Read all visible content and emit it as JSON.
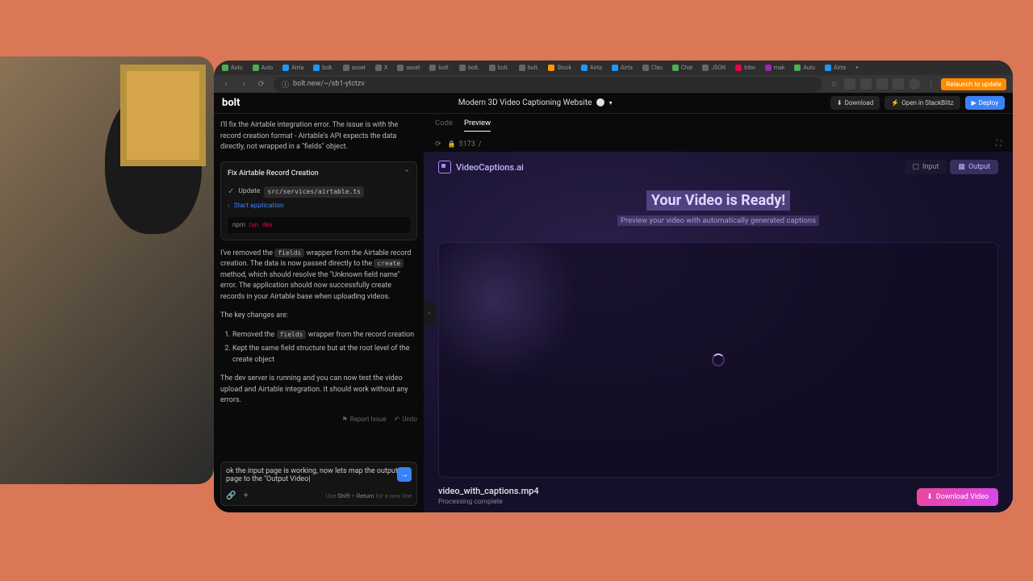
{
  "browser": {
    "tabs": [
      {
        "icon": "green",
        "label": "Auto"
      },
      {
        "icon": "green",
        "label": "Auto"
      },
      {
        "icon": "blue",
        "label": "Airta"
      },
      {
        "icon": "blue",
        "label": "bolt."
      },
      {
        "icon": "gray",
        "label": "asset"
      },
      {
        "icon": "gray",
        "label": "X"
      },
      {
        "icon": "gray",
        "label": "asset"
      },
      {
        "icon": "gray",
        "label": "bolt."
      },
      {
        "icon": "gray",
        "label": "bolt."
      },
      {
        "icon": "gray",
        "label": "bolt."
      },
      {
        "icon": "gray",
        "label": "bolt."
      },
      {
        "icon": "orange",
        "label": "Stock"
      },
      {
        "icon": "blue",
        "label": "Airta"
      },
      {
        "icon": "blue",
        "label": "Airta"
      },
      {
        "icon": "gray",
        "label": "Clau"
      },
      {
        "icon": "green",
        "label": "Chat"
      },
      {
        "icon": "gray",
        "label": "JSON"
      },
      {
        "icon": "red",
        "label": "Inbo"
      },
      {
        "icon": "purple",
        "label": "mak"
      },
      {
        "icon": "green",
        "label": "Auto"
      },
      {
        "icon": "blue",
        "label": "Airta"
      }
    ],
    "url": "bolt.new/~/sb1-ytctzv",
    "relaunch": "Relaunch to update"
  },
  "header": {
    "logo": "bolt",
    "project": "Modern 3D Video Captioning Website",
    "download": "Download",
    "stackblitz": "Open in StackBlitz",
    "deploy": "Deploy"
  },
  "chat": {
    "intro": "I'll fix the Airtable integration error. The issue is with the record creation format - Airtable's API expects the data directly, not wrapped in a \"fields\" object.",
    "fix_title": "Fix Airtable Record Creation",
    "step_update": "Update",
    "step_file": "src/services/airtable.ts",
    "step_start": "Start application",
    "cmd_npm": "npm",
    "cmd_run": "run",
    "cmd_dev": "dev",
    "p2a": "I've removed the ",
    "p2_code1": "fields",
    "p2b": " wrapper from the Airtable record creation. The data is now passed directly to the ",
    "p2_code2": "create",
    "p2c": " method, which should resolve the \"Unknown field name\" error. The application should now successfully create records in your Airtable base when uploading videos.",
    "p3": "The key changes are:",
    "li1a": "Removed the ",
    "li1_code": "fields",
    "li1b": " wrapper from the record creation",
    "li2": "Kept the same field structure but at the root level of the create object",
    "p4": "The dev server is running and you can now test the video upload and Airtable integration. It should work without any errors.",
    "report": "Report Issue",
    "undo": "Undo",
    "input_text": "ok the input page is working, now lets map the output page to the \"Output Video",
    "hint_use": "Use",
    "hint_shift": "Shift",
    "hint_plus": "+",
    "hint_return": "Return",
    "hint_rest": "for a new line"
  },
  "preview": {
    "tab_code": "Code",
    "tab_preview": "Preview",
    "port": "5173",
    "path": "/",
    "brand": "VideoCaptions.ai",
    "tab_input": "Input",
    "tab_output": "Output",
    "hero_title": "Your Video is Ready!",
    "hero_sub": "Preview your video with automatically generated captions",
    "filename": "video_with_captions.mp4",
    "status": "Processing complete",
    "download": "Download Video"
  }
}
